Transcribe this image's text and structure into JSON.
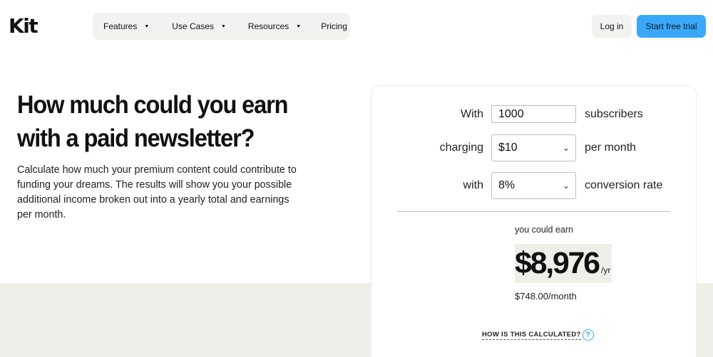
{
  "nav": {
    "logo": "Kit",
    "menu": [
      {
        "label": "Features",
        "has_caret": true
      },
      {
        "label": "Use Cases",
        "has_caret": true
      },
      {
        "label": "Resources",
        "has_caret": true
      },
      {
        "label": "Pricing",
        "has_caret": false
      }
    ],
    "login_label": "Log in",
    "trial_label": "Start free trial"
  },
  "hero": {
    "headline": "How much could you earn with a paid newsletter?",
    "subtext": "Calculate how much your premium content could contribute to funding your dreams. The results will show you your possible additional income broken out into a yearly total and earnings per month."
  },
  "calculator": {
    "subscribers": {
      "label": "With",
      "value": "1000",
      "suffix": "subscribers"
    },
    "price": {
      "label": "charging",
      "value": "$10",
      "suffix": "per month"
    },
    "conversion": {
      "label": "with",
      "value": "8%",
      "suffix": "conversion rate"
    },
    "result": {
      "label": "you could earn",
      "yearly": "$8,976",
      "yearly_unit": "/yr",
      "monthly": "$748.00/month"
    },
    "how_label": "HOW IS THIS CALCULATED?",
    "help_glyph": "?"
  },
  "colors": {
    "accent_blue": "#3aa8f8",
    "beige": "#efeee9",
    "menu_bg": "#f2f2f1"
  },
  "icons": {
    "caret": "caret-down-icon",
    "chevron": "chevron-down-icon",
    "help": "help-circle-icon"
  }
}
